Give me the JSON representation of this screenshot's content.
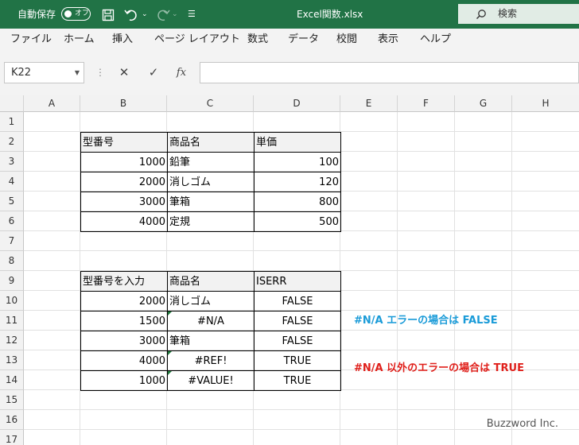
{
  "titlebar": {
    "autosave_label": "自動保存",
    "autosave_state": "オフ",
    "filename": "Excel関数.xlsx",
    "search_label": "検索",
    "bg_color": "#217346"
  },
  "menu": [
    "ファイル",
    "ホーム",
    "挿入",
    "ページ レイアウト",
    "数式",
    "データ",
    "校閲",
    "表示",
    "ヘルプ"
  ],
  "formula_bar": {
    "name_box": "K22",
    "formula": "",
    "fx_label": "fx"
  },
  "columns": [
    "A",
    "B",
    "C",
    "D",
    "E",
    "F",
    "G",
    "H"
  ],
  "rows": [
    "1",
    "2",
    "3",
    "4",
    "5",
    "6",
    "7",
    "8",
    "9",
    "10",
    "11",
    "12",
    "13",
    "14",
    "15",
    "16",
    "17"
  ],
  "table1": {
    "headers": [
      "型番号",
      "商品名",
      "単価"
    ],
    "rows": [
      [
        "1000",
        "鉛筆",
        "100"
      ],
      [
        "2000",
        "消しゴム",
        "120"
      ],
      [
        "3000",
        "筆箱",
        "800"
      ],
      [
        "4000",
        "定規",
        "500"
      ]
    ]
  },
  "table2": {
    "headers": [
      "型番号を入力",
      "商品名",
      "ISERR"
    ],
    "rows": [
      [
        "2000",
        "消しゴム",
        "FALSE"
      ],
      [
        "1500",
        "#N/A",
        "FALSE"
      ],
      [
        "3000",
        "筆箱",
        "FALSE"
      ],
      [
        "4000",
        "#REF!",
        "TRUE"
      ],
      [
        "1000",
        "#VALUE!",
        "TRUE"
      ]
    ]
  },
  "notes": {
    "na_false": "#N/A エラーの場合は FALSE",
    "other_true": "#N/A 以外のエラーの場合は TRUE",
    "na_color": "#1a9bd8",
    "other_color": "#e0201b"
  },
  "watermark": "Buzzword Inc."
}
